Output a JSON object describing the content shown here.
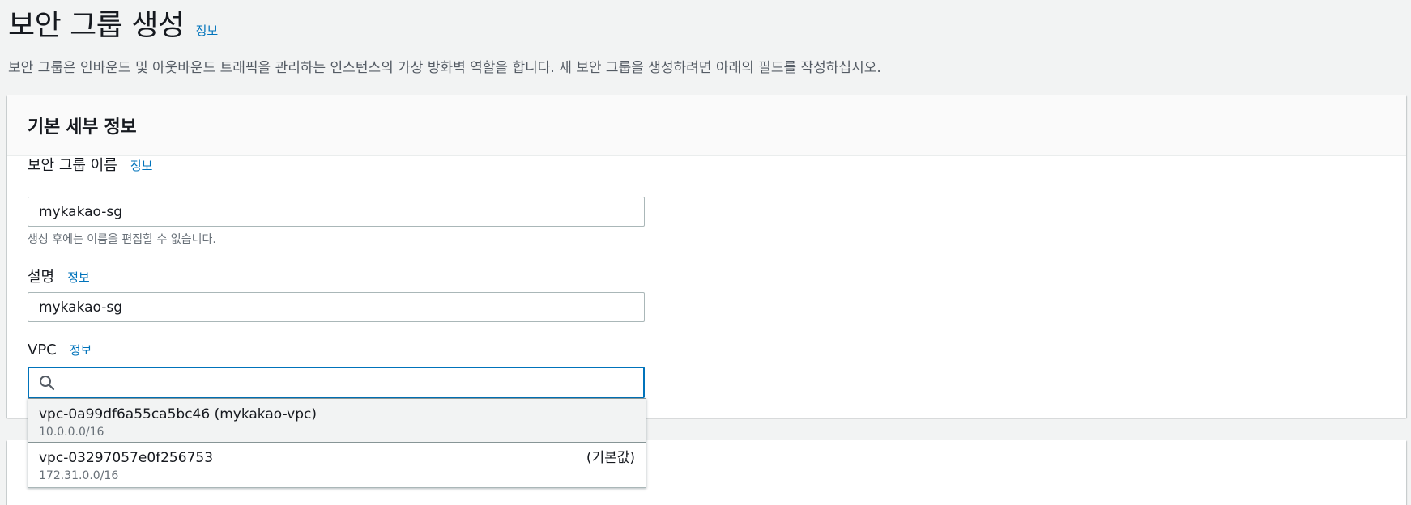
{
  "page": {
    "title": "보안 그룹 생성",
    "info_link": "정보",
    "description": "보안 그룹은 인바운드 및 아웃바운드 트래픽을 관리하는 인스턴스의 가상 방화벽 역할을 합니다. 새 보안 그룹을 생성하려면 아래의 필드를 작성하십시오."
  },
  "basic_details": {
    "title": "기본 세부 정보",
    "name_field": {
      "label": "보안 그룹 이름",
      "info_link": "정보",
      "value": "mykakao-sg",
      "hint": "생성 후에는 이름을 편집할 수 없습니다."
    },
    "description_field": {
      "label": "설명",
      "info_link": "정보",
      "value": "mykakao-sg"
    },
    "vpc_field": {
      "label": "VPC",
      "info_link": "정보",
      "search_value": "",
      "options": [
        {
          "label": "vpc-0a99df6a55ca5bc46 (mykakao-vpc)",
          "description": "10.0.0.0/16",
          "tag": ""
        },
        {
          "label": "vpc-03297057e0f256753",
          "description": "172.31.0.0/16",
          "tag": "(기본값)"
        }
      ]
    }
  },
  "colors": {
    "link": "#0073bb",
    "focus_border": "#0073bb",
    "background": "#f2f3f3",
    "text": "#16191f",
    "secondary_text": "#687078"
  }
}
